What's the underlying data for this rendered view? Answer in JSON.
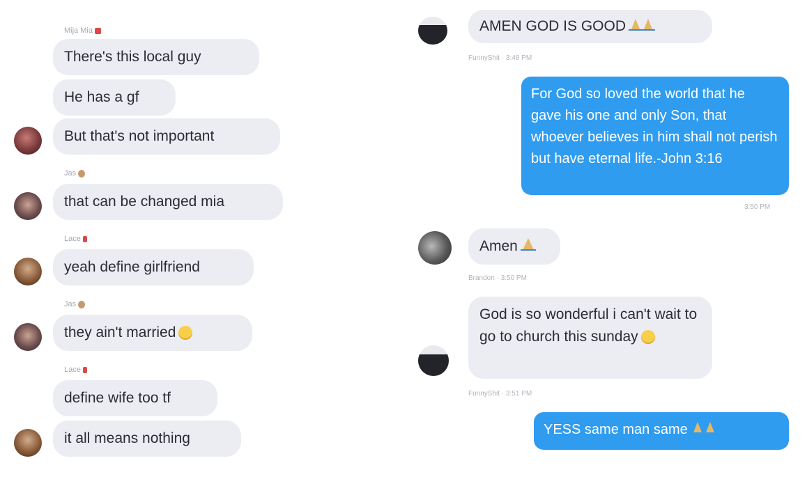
{
  "left": {
    "names": {
      "mija": "Mija Mia",
      "jas1": "Jas",
      "lace1": "Lace",
      "jas2": "Jas",
      "lace2": "Lace"
    },
    "messages": [
      "There's this local guy",
      "He has a gf",
      "But that's not important",
      "that can be changed mia",
      "yeah define girlfriend",
      "they ain't married",
      "define wife too tf",
      "it all means nothing"
    ]
  },
  "right": {
    "top_message": "AMEN GOD IS GOOD",
    "top_meta": "FunnyShit · 3:48 PM",
    "outgoing_verse": "For God so loved the world that he gave his one and only Son, that whoever believes in him shall not perish but have eternal life.-John 3:16",
    "verse_time": "3:50 PM",
    "amen": "Amen",
    "amen_meta": "Brandon · 3:50 PM",
    "wonderful": "God is so wonderful i can't wait to go to church this sunday",
    "wonderful_meta": "FunnyShit · 3:51 PM",
    "yess": "YESS same man same"
  },
  "colors": {
    "incoming_bubble": "#ececf3",
    "outgoing_bubble": "#2f9cf0",
    "meta_text": "#a8a8b4"
  }
}
